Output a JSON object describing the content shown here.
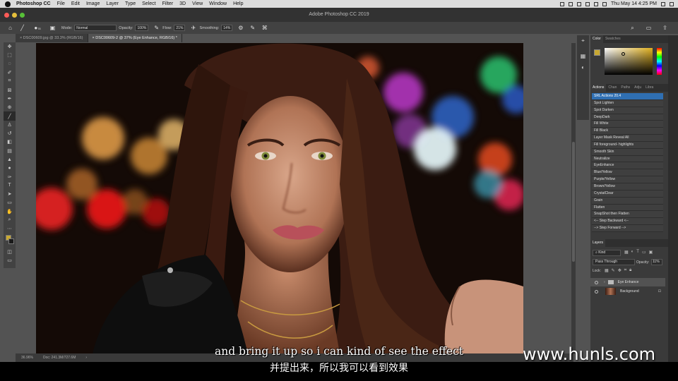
{
  "macos_menubar": {
    "app": "Photoshop CC",
    "items": [
      "File",
      "Edit",
      "Image",
      "Layer",
      "Type",
      "Select",
      "Filter",
      "3D",
      "View",
      "Window",
      "Help"
    ],
    "clock": "Thu May 14  4:25 PM"
  },
  "window": {
    "title": "Adobe Photoshop CC 2019"
  },
  "options_bar": {
    "brush_size": "78",
    "mode_label": "Mode:",
    "mode_value": "Normal",
    "opacity_label": "Opacity:",
    "opacity_value": "100%",
    "flow_label": "Flow:",
    "flow_value": "21%",
    "smoothing_label": "Smoothing:",
    "smoothing_value": "14%"
  },
  "doc_tabs": [
    {
      "label": "DSC00609.jpg @ 33.3% (RGB/16)",
      "active": false
    },
    {
      "label": "DSC00609-2 @ 37% (Eye Enhance, RGB/16) *",
      "active": true
    }
  ],
  "status_bar": {
    "zoom": "36.96%",
    "doc": "Doc: 241.3M/727.6M"
  },
  "color_panel": {
    "tabs": [
      "Color",
      "Swatches"
    ],
    "accent": "#c8a832"
  },
  "actions_panel": {
    "tabs": [
      "Actions",
      "Chan",
      "Paths",
      "Adju",
      "Libra"
    ],
    "items": [
      "SRL Actions 20.4",
      "Spot Lighten",
      "Spot Darken",
      "DeepDark",
      "Fill White",
      "Fill Black",
      "Layer Mask Reveal All",
      "Fill foreground- highlights",
      "Smooth Skin",
      "Neutralize",
      "EyeEnhance",
      "Blue/Yellow",
      "Purple/Yellow",
      "Brown/Yellow",
      "CrystalClear",
      "Grain",
      "Flatten",
      "SnapShot then Flatten",
      "<-- Step Backward <--",
      "--> Step Forward -->"
    ]
  },
  "layers_panel": {
    "title": "Layers",
    "filter": "Kind",
    "blend_mode": "Pass Through",
    "opacity_label": "Opacity:",
    "opacity_value": "11%",
    "lock_label": "Lock:",
    "layers": [
      {
        "name": "Eye Enhance",
        "type": "group",
        "selected": true
      },
      {
        "name": "Background",
        "type": "image",
        "selected": false
      }
    ]
  },
  "subtitles": {
    "en": "and bring it up so i can kind of see the effect",
    "cn": "并提出来，所以我可以看到效果"
  },
  "watermark": "www.hunls.com"
}
